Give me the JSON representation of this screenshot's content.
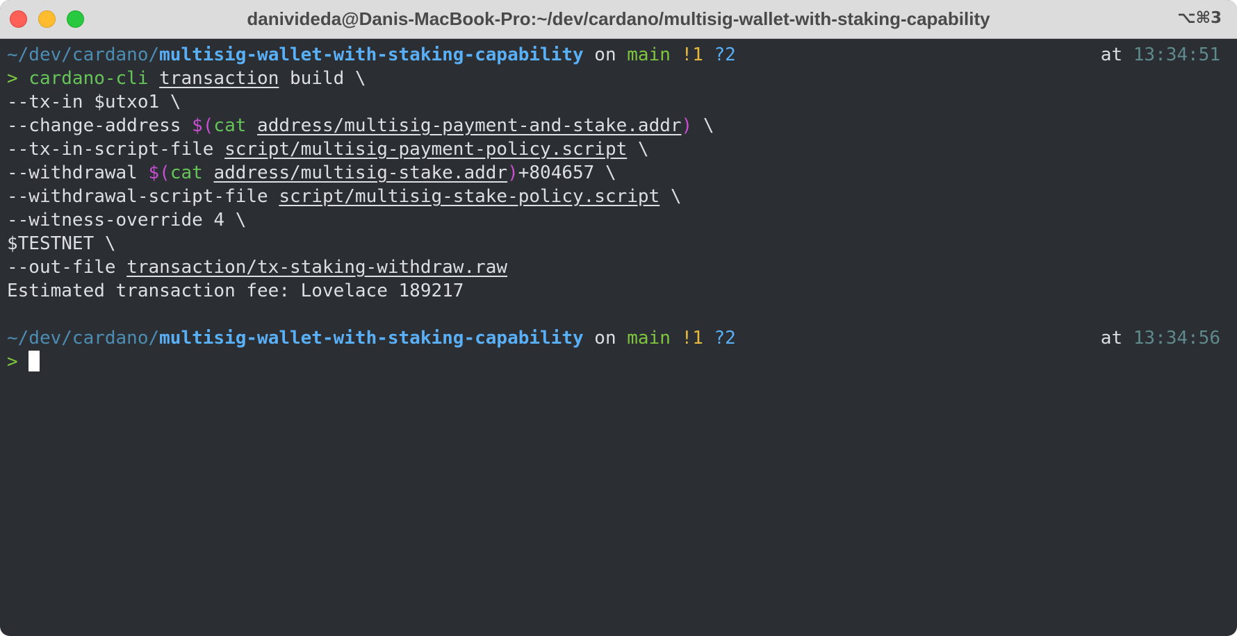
{
  "window": {
    "title": "danivideda@Danis-MacBook-Pro:~/dev/cardano/multisig-wallet-with-staking-capability",
    "shortcut": "⌥⌘3"
  },
  "prompt1": {
    "dir": "~/dev/cardano/",
    "repo": "multisig-wallet-with-staking-capability",
    "on": " on ",
    "branch": "main",
    "modified": " !1",
    "untracked": " ?2",
    "at": "at ",
    "time": "13:34:51"
  },
  "command": {
    "prompt_char": "> ",
    "line1": {
      "cmd": "cardano-cli",
      "sp": " ",
      "arg": "transaction",
      "rest": " build \\"
    },
    "line2": "--tx-in $utxo1 \\",
    "line3": {
      "pre": "--change-address ",
      "sub_open": "$(",
      "cat": "cat",
      "sp": " ",
      "path": "address/multisig-payment-and-stake.addr",
      "sub_close": ")",
      "post": " \\"
    },
    "line4": {
      "pre": "--tx-in-script-file ",
      "path": "script/multisig-payment-policy.script",
      "post": " \\"
    },
    "line5": {
      "pre": "--withdrawal ",
      "sub_open": "$(",
      "cat": "cat",
      "sp": " ",
      "path": "address/multisig-stake.addr",
      "sub_close": ")",
      "post": "+804657 \\"
    },
    "line6": {
      "pre": "--withdrawal-script-file ",
      "path": "script/multisig-stake-policy.script",
      "post": " \\"
    },
    "line7": "--witness-override 4 \\",
    "line8": "$TESTNET \\",
    "line9": {
      "pre": "--out-file ",
      "path": "transaction/tx-staking-withdraw.raw"
    }
  },
  "output": "Estimated transaction fee: Lovelace 189217",
  "prompt2": {
    "dir": "~/dev/cardano/",
    "repo": "multisig-wallet-with-staking-capability",
    "on": " on ",
    "branch": "main",
    "modified": " !1",
    "untracked": " ?2",
    "at": "at ",
    "time": "13:34:56",
    "prompt_char": "> "
  }
}
